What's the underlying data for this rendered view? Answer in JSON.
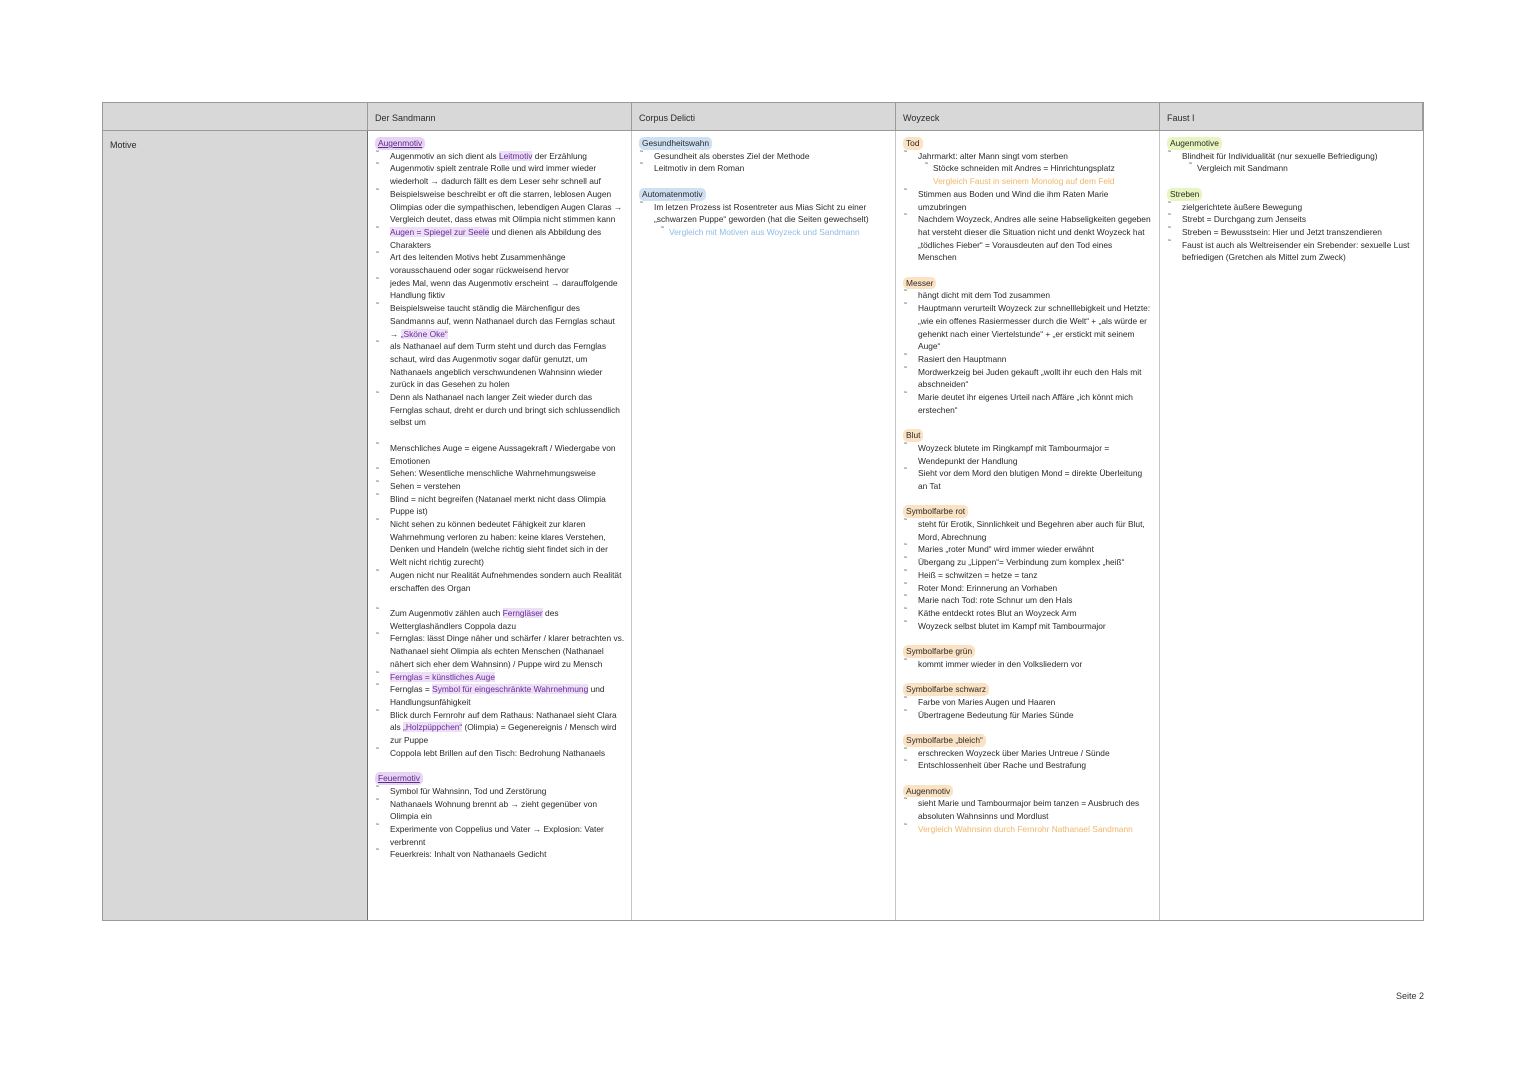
{
  "headers": [
    "",
    "Der Sandmann",
    "Corpus Delicti",
    "Woyzeck",
    "Faust I"
  ],
  "row_label": "Motive",
  "sandmann": {
    "cat1": "Augenmotiv",
    "items1": [
      {
        "pre": " Augenmotiv an sich dient als ",
        "hl": "Leitmotiv",
        "post": " der Erzählung"
      },
      {
        "pre": "Augenmotiv spielt zentrale Rolle und wird immer wieder wiederholt → dadurch fällt es dem Leser sehr schnell auf",
        "hl": "",
        "post": ""
      },
      {
        "pre": "Beispielsweise beschreibt er oft die starren, leblosen Augen Olimpias oder die sympathischen, lebendigen Augen Claras → Vergleich deutet, dass etwas mit Olimpia nicht stimmen kann",
        "hl": "",
        "post": ""
      },
      {
        "pre": "",
        "hl": "Augen = Spiegel zur Seele",
        "post": " und dienen als Abbildung des Charakters"
      },
      {
        "pre": "Art des leitenden Motivs hebt Zusammenhänge vorausschauend oder sogar rückweisend hervor",
        "hl": "",
        "post": ""
      },
      {
        "pre": "jedes Mal, wenn das Augenmotiv erscheint → darauffolgende Handlung fiktiv",
        "hl": "",
        "post": ""
      },
      {
        "pre": "Beispielsweise taucht ständig die Märchenfigur des Sandmanns auf, wenn Nathanael durch das Fernglas schaut → ",
        "hl": "„Sköne Oke“",
        "post": ""
      },
      {
        "pre": "als Nathanael auf dem Turm steht und durch das Fernglas schaut, wird das Augenmotiv sogar dafür genutzt, um Nathanaels angeblich verschwundenen Wahnsinn wieder zurück in das Gesehen zu holen",
        "hl": "",
        "post": ""
      },
      {
        "pre": "Denn als Nathanael nach langer Zeit wieder durch das Fernglas schaut, dreht er durch und bringt sich schlussendlich selbst um",
        "hl": "",
        "post": ""
      }
    ],
    "items2": [
      {
        "pre": "Menschliches Auge = eigene Aussagekraft / Wiedergabe von Emotionen",
        "hl": "",
        "post": ""
      },
      {
        "pre": "Sehen: Wesentliche menschliche Wahrnehmungsweise",
        "hl": "",
        "post": ""
      },
      {
        "pre": "Sehen = verstehen",
        "hl": "",
        "post": ""
      },
      {
        "pre": "Blind = nicht begreifen (Natanael merkt nicht dass Olimpia Puppe ist)",
        "hl": "",
        "post": ""
      },
      {
        "pre": "Nicht sehen zu können bedeutet Fähigkeit zur klaren Wahrnehmung verloren zu haben: keine klares Verstehen,  Denken und Handeln (welche richtig sieht findet sich in der Welt nicht richtig zurecht)",
        "hl": "",
        "post": ""
      },
      {
        "pre": "Augen nicht nur Realität Aufnehmendes sondern auch Realität erschaffen des Organ",
        "hl": "",
        "post": ""
      }
    ],
    "items3": [
      {
        "pre": "Zum Augenmotiv zählen auch ",
        "hl": "Ferngläser",
        "post": " des Wetterglashändlers Coppola dazu"
      },
      {
        "pre": "Fernglas: lässt Dinge näher und schärfer / klarer betrachten vs. Nathanael sieht Olimpia als echten Menschen (Nathanael nähert sich eher dem Wahnsinn) / Puppe wird zu Mensch",
        "hl": "",
        "post": ""
      },
      {
        "pre": "",
        "hl": "Fernglas = künstliches Auge",
        "post": ""
      },
      {
        "pre": "Fernglas = ",
        "hl": "Symbol für eingeschränkte Wahrnehmung",
        "post": " und Handlungsunfähigkeit"
      },
      {
        "pre": "Blick durch Fernrohr auf dem Rathaus: Nathanael sieht Clara als ",
        "hl": "„Holzpüppchen“",
        "post": " (Olimpia) = Gegenereignis / Mensch wird zur Puppe"
      },
      {
        "pre": "Coppola lebt Brillen auf den Tisch: Bedrohung Nathanaels",
        "hl": "",
        "post": ""
      }
    ],
    "cat2": "Feuermotiv",
    "items4": [
      "Symbol für Wahnsinn, Tod und Zerstörung",
      "Nathanaels Wohnung brennt ab → zieht gegenüber von Olimpia ein",
      "Experimente von Coppelius und Vater → Explosion: Vater verbrennt",
      "Feuerkreis: Inhalt von Nathanaels Gedicht"
    ]
  },
  "corpus": {
    "cat1": "Gesundheitswahn",
    "items1": [
      "Gesundheit als oberstes Ziel der Methode",
      "Leitmotiv in dem Roman"
    ],
    "cat2": "Automatenmotiv",
    "items2": [
      "Im letzen Prozess ist Rosentreter aus Mias Sicht zu einer „schwarzen Puppe“ geworden (hat die Seiten gewechselt)"
    ],
    "note2": "Vergleich mit Motiven aus Woyzeck und Sandmann"
  },
  "woyzeck": {
    "cat1": "Tod",
    "items1a": "Jahrmarkt: alter Mann singt vom sterben",
    "items1b": "Stöcke schneiden mit Andres = Hinrichtungsplatz",
    "note1": "Vergleich Faust in seinem Monolog auf dem Feld",
    "items1c": [
      "Stimmen aus Boden und Wind die ihm Raten Marie umzubringen",
      "Nachdem Woyzeck, Andres alle seine Habseligkeiten gegeben hat versteht dieser die Situation nicht und denkt Woyzeck hat „tödliches Fieber“ =  Vorausdeuten auf den Tod eines Menschen"
    ],
    "cat2": "Messer",
    "items2": [
      "hängt dicht mit dem Tod zusammen",
      "Hauptmann verurteilt Woyzeck zur schnelllebigkeit und Hetzte: „wie ein offenes Rasiermesser durch die Welt“ + „als würde er gehenkt nach einer Viertelstunde“ + „er erstickt mit seinem Auge“",
      "Rasiert den Hauptmann",
      "Mordwerkzeig bei Juden gekauft „wollt ihr euch den Hals mit abschneiden“",
      "Marie deutet ihr eigenes Urteil nach Affäre „ich könnt mich erstechen“"
    ],
    "cat3": "Blut",
    "items3": [
      "Woyzeck blutete im Ringkampf mit Tambourmajor = Wendepunkt der Handlung",
      "Sieht vor dem Mord den blutigen Mond = direkte Überleitung an Tat"
    ],
    "cat4": "Symbolfarbe rot",
    "items4": [
      "steht für Erotik, Sinnlichkeit und Begehren aber auch für Blut, Mord, Abrechnung",
      "Maries „roter Mund“ wird immer wieder erwähnt",
      "Übergang zu „Lippen“= Verbindung zum komplex „heiß“",
      "Heiß = schwitzen = hetze = tanz",
      "Roter Mond: Erinnerung an Vorhaben",
      "Marie nach Tod: rote Schnur um den Hals",
      "Käthe entdeckt rotes Blut an Woyzeck Arm",
      "Woyzeck selbst blutet im Kampf mit Tambourmajor"
    ],
    "cat5": "Symbolfarbe grün",
    "items5": [
      "kommt immer wieder in den Volksliedern vor"
    ],
    "cat6": "Symbolfarbe schwarz",
    "items6": [
      "Farbe von Maries Augen und Haaren",
      "Übertragene Bedeutung für Maries Sünde"
    ],
    "cat7": "Symbolfarbe „bleich“",
    "items7": [
      "erschrecken Woyzeck über Maries Untreue / Sünde",
      "Entschlossenheit über Rache und  Bestrafung"
    ],
    "cat8": "Augenmotiv",
    "items8": [
      "sieht Marie und Tambourmajor beim tanzen = Ausbruch des absoluten Wahnsinns und Mordlust"
    ],
    "note8": "Vergleich Wahnsinn durch Fernrohr Nathanael Sandmann"
  },
  "faust": {
    "cat1": "Augenmotive",
    "item1": "Blindheit für Individualität (nur sexuelle Befriedigung)",
    "item1sub": "Vergleich mit Sandmann",
    "cat2": "Streben",
    "items2": [
      "zielgerichtete äußere Bewegung",
      "Strebt = Durchgang zum Jenseits",
      "Streben = Bewusstsein:  Hier und Jetzt transzendieren",
      "Faust ist auch als Weltreisender ein Srebender: sexuelle Lust befriedigen (Gretchen als Mittel zum Zweck)"
    ]
  },
  "footer": "Seite 2"
}
